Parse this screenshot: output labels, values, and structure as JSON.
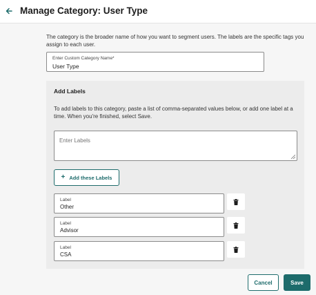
{
  "header": {
    "back_icon": "arrow-left-icon",
    "title": "Manage Category: User Type"
  },
  "description": "The category is the broader name of how you want to segment users. The labels are the specific tags you assign to each user.",
  "category_name": {
    "label": "Enter Custom Category Name*",
    "value": "User Type"
  },
  "add_labels": {
    "title": "Add Labels",
    "instructions": "To add labels to this category, paste a list of comma-separated values below, or add one label at a time. When you're finished, select Save.",
    "textarea_placeholder": "Enter Labels",
    "add_button_label": "Add these Labels",
    "add_button_icon": "plus-icon"
  },
  "labels": [
    {
      "field_label": "Label",
      "value": "Other"
    },
    {
      "field_label": "Label",
      "value": "Advisor"
    },
    {
      "field_label": "Label",
      "value": "CSA"
    }
  ],
  "delete_icon": "trash-icon",
  "footer": {
    "cancel_label": "Cancel",
    "save_label": "Save"
  },
  "colors": {
    "accent": "#1d6b6b",
    "panel_background": "#ececec",
    "page_background": "#f6f6f6"
  }
}
